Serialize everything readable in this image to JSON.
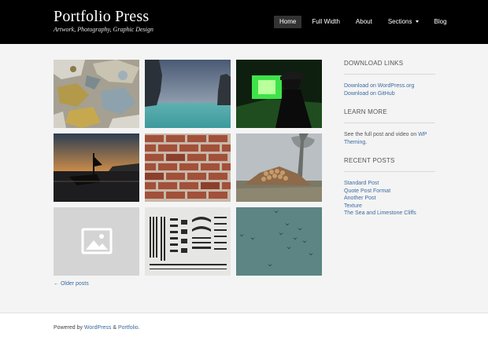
{
  "site": {
    "title": "Portfolio Press",
    "tagline": "Artwork, Photography, Graphic Design"
  },
  "nav": {
    "items": [
      "Home",
      "Full Width",
      "About",
      "Sections",
      "Blog"
    ],
    "active": "Home"
  },
  "grid": {
    "tiles": [
      {
        "name": "peeling-paint"
      },
      {
        "name": "sea-cliffs"
      },
      {
        "name": "green-light-silhouette"
      },
      {
        "name": "boat-sunset"
      },
      {
        "name": "brick-wall"
      },
      {
        "name": "firewood-pile"
      },
      {
        "name": "placeholder-image"
      },
      {
        "name": "design-elements-sheet"
      },
      {
        "name": "birds-sky"
      }
    ]
  },
  "pagination": {
    "older_label": "← Older posts"
  },
  "sidebar": {
    "download": {
      "title": "DOWNLOAD LINKS",
      "links": [
        "Download on WordPress.org",
        "Download on GitHub"
      ]
    },
    "learn": {
      "title": "LEARN MORE",
      "text_before": "See the full post and video on ",
      "link": "WP Theming",
      "text_after": "."
    },
    "recent": {
      "title": "RECENT POSTS",
      "links": [
        "Standard Post",
        "Quote Post Format",
        "Another Post",
        "Texture",
        "The Sea and Limestone Cliffs"
      ]
    }
  },
  "footer": {
    "prefix": "Powered by ",
    "wordpress": "WordPress",
    "amp": " & ",
    "portfolio": "Portfolio",
    "suffix": "."
  },
  "colors": {
    "header_bg": "#000000",
    "link": "#3b6ba0",
    "page_bg": "#f4f4f4"
  }
}
